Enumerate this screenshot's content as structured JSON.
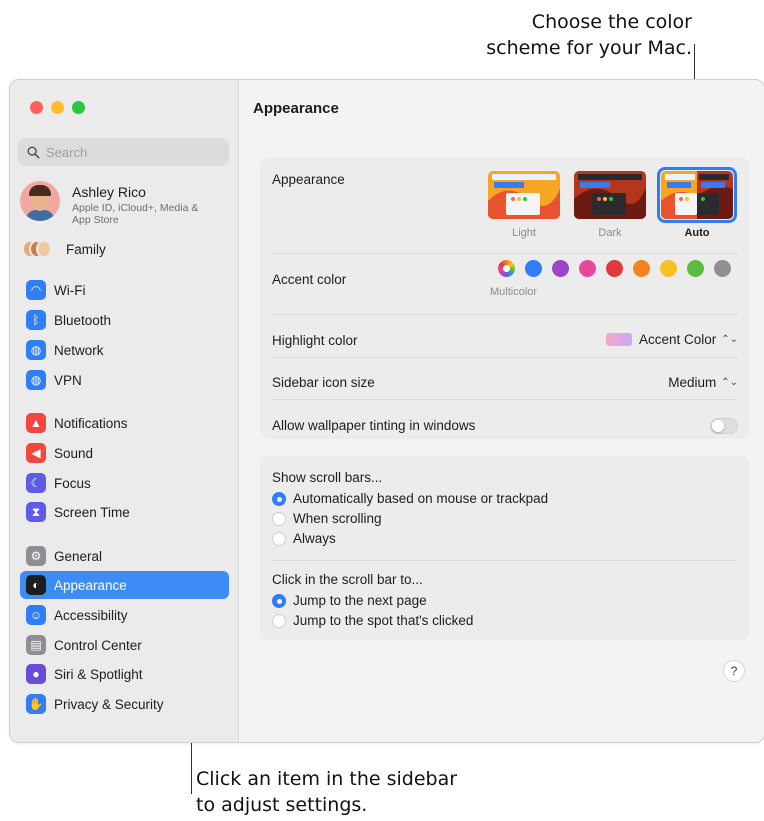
{
  "callouts": {
    "top_line1": "Choose the color",
    "top_line2": "scheme for your Mac.",
    "bottom_line1": "Click an item in the sidebar",
    "bottom_line2": "to adjust settings."
  },
  "sidebar": {
    "search_placeholder": "Search",
    "account": {
      "name": "Ashley Rico",
      "subtitle": "Apple ID, iCloud+, Media & App Store"
    },
    "family_label": "Family",
    "items": [
      {
        "label": "Wi-Fi",
        "icon": "wifi-icon",
        "color": "#2f7ef5"
      },
      {
        "label": "Bluetooth",
        "icon": "bluetooth-icon",
        "color": "#2f7ef5"
      },
      {
        "label": "Network",
        "icon": "globe-icon",
        "color": "#2f7ef5"
      },
      {
        "label": "VPN",
        "icon": "vpn-globe-icon",
        "color": "#2f7ef5"
      },
      {
        "label": "Notifications",
        "icon": "bell-icon",
        "color": "#f2473f"
      },
      {
        "label": "Sound",
        "icon": "speaker-icon",
        "color": "#f2473f"
      },
      {
        "label": "Focus",
        "icon": "moon-icon",
        "color": "#5e5ce6"
      },
      {
        "label": "Screen Time",
        "icon": "hourglass-icon",
        "color": "#5e5ce6"
      },
      {
        "label": "General",
        "icon": "gear-icon",
        "color": "#8e8e93"
      },
      {
        "label": "Appearance",
        "icon": "appearance-icon",
        "color": "#1d1d1f",
        "selected": true
      },
      {
        "label": "Accessibility",
        "icon": "accessibility-icon",
        "color": "#2f7ef5"
      },
      {
        "label": "Control Center",
        "icon": "control-center-icon",
        "color": "#8e8e93"
      },
      {
        "label": "Siri & Spotlight",
        "icon": "siri-icon",
        "color": "#6b4cd8"
      },
      {
        "label": "Privacy & Security",
        "icon": "hand-icon",
        "color": "#2f7ef5"
      }
    ]
  },
  "main": {
    "title": "Appearance",
    "appearance": {
      "label": "Appearance",
      "options": [
        {
          "caption": "Light",
          "selected": false
        },
        {
          "caption": "Dark",
          "selected": false
        },
        {
          "caption": "Auto",
          "selected": true
        }
      ]
    },
    "accent": {
      "label": "Accent color",
      "selected_caption": "Multicolor",
      "colors": [
        "#2f7ef5",
        "#9b46c8",
        "#e8489a",
        "#e0383e",
        "#f5821f",
        "#f7c025",
        "#5dbb3f",
        "#8e8e93"
      ]
    },
    "highlight": {
      "label": "Highlight color",
      "value": "Accent Color"
    },
    "icon_size": {
      "label": "Sidebar icon size",
      "value": "Medium"
    },
    "tinting": {
      "label": "Allow wallpaper tinting in windows",
      "enabled": false
    },
    "scroll": {
      "label": "Show scroll bars...",
      "options": [
        {
          "label": "Automatically based on mouse or trackpad",
          "selected": true
        },
        {
          "label": "When scrolling",
          "selected": false
        },
        {
          "label": "Always",
          "selected": false
        }
      ]
    },
    "click": {
      "label": "Click in the scroll bar to...",
      "options": [
        {
          "label": "Jump to the next page",
          "selected": true
        },
        {
          "label": "Jump to the spot that's clicked",
          "selected": false
        }
      ]
    },
    "help": "?"
  }
}
